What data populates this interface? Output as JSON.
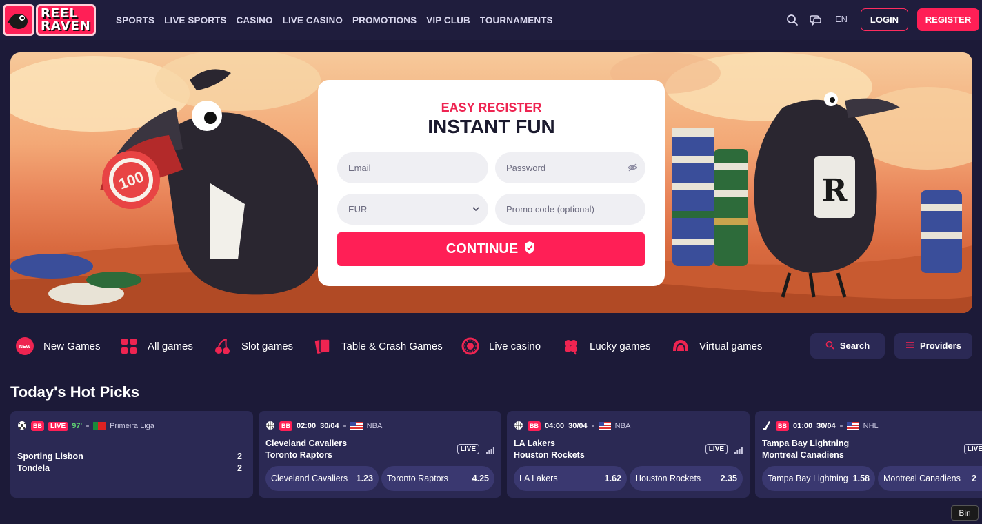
{
  "header": {
    "logo_line1": "REEL",
    "logo_line2": "RAVEN",
    "nav": [
      "SPORTS",
      "LIVE SPORTS",
      "CASINO",
      "LIVE CASINO",
      "PROMOTIONS",
      "VIP CLUB",
      "TOURNAMENTS"
    ],
    "language": "EN",
    "login_label": "LOGIN",
    "register_label": "REGISTER"
  },
  "register_card": {
    "subtitle": "EASY REGISTER",
    "title": "INSTANT FUN",
    "email_placeholder": "Email",
    "password_placeholder": "Password",
    "currency": "EUR",
    "promo_placeholder": "Promo code (optional)",
    "continue_label": "CONTINUE",
    "chip_value": "100"
  },
  "categories": [
    "New Games",
    "All games",
    "Slot games",
    "Table & Crash Games",
    "Live casino",
    "Lucky games",
    "Virtual games"
  ],
  "new_badge": "NEW",
  "search_label": "Search",
  "providers_label": "Providers",
  "hot_picks_title": "Today's Hot Picks",
  "matches": [
    {
      "badge": "BB",
      "live": "LIVE",
      "minute": "97'",
      "league": "Primeira Liga",
      "home": "Sporting Lisbon",
      "away": "Tondela",
      "home_score": "2",
      "away_score": "2"
    },
    {
      "badge": "BB",
      "time": "02:00",
      "date": "30/04",
      "league": "NBA",
      "home": "Cleveland Cavaliers",
      "away": "Toronto Raptors",
      "live_tag": "LIVE",
      "odds": [
        {
          "name": "Cleveland Cavaliers",
          "value": "1.23"
        },
        {
          "name": "Toronto Raptors",
          "value": "4.25"
        }
      ]
    },
    {
      "badge": "BB",
      "time": "04:00",
      "date": "30/04",
      "league": "NBA",
      "home": "LA Lakers",
      "away": "Houston Rockets",
      "live_tag": "LIVE",
      "odds": [
        {
          "name": "LA Lakers",
          "value": "1.62"
        },
        {
          "name": "Houston Rockets",
          "value": "2.35"
        }
      ]
    },
    {
      "badge": "BB",
      "time": "01:00",
      "date": "30/04",
      "league": "NHL",
      "home": "Tampa Bay Lightning",
      "away": "Montreal Canadiens",
      "live_tag": "LIVE",
      "odds": [
        {
          "name": "Tampa Bay Lightning",
          "value": "1.58"
        },
        {
          "name": "Montreal Canadiens",
          "value": "2"
        }
      ]
    }
  ],
  "tooltip": "Bin",
  "colors": {
    "accent": "#ff1f56",
    "background": "#1c1a38",
    "card": "#2b2954"
  }
}
